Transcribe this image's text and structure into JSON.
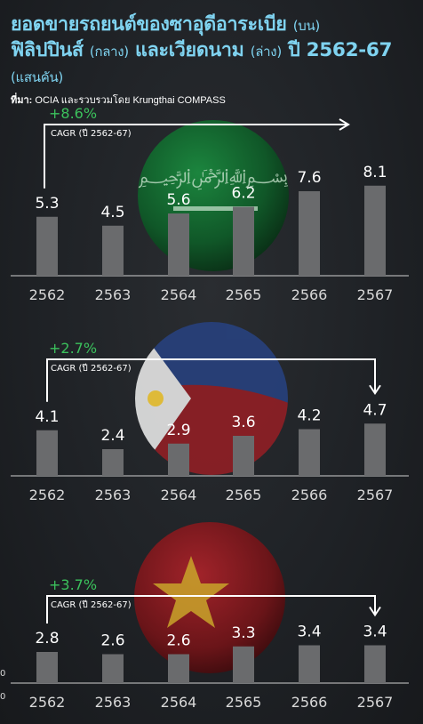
{
  "header": {
    "title_line1": "ยอดขายรถยนต์ของซาอุดีอาระเบีย",
    "title_line1_note": "(บน)",
    "title_line2_a": "ฟิลิปปินส์",
    "title_line2_a_note": "(กลาง)",
    "title_line2_b": "และเวียดนาม",
    "title_line2_b_note": "(ล่าง)",
    "title_line2_c": "ปี 2562-67",
    "title_unit": "(แสนคัน)",
    "source_label": "ที่มา:",
    "source_text": "OCIA และรวบรวมโดย Krungthai COMPASS"
  },
  "chart_data": [
    {
      "type": "bar",
      "title": "",
      "categories": [
        "2562",
        "2563",
        "2564",
        "2565",
        "2566",
        "2567"
      ],
      "values": [
        5.3,
        4.5,
        5.6,
        6.2,
        7.6,
        8.1
      ],
      "value_labels": [
        "5.3",
        "4.5",
        "5.6",
        "6.2",
        "7.6",
        "8.1"
      ],
      "ylim": [
        0,
        9
      ],
      "cagr": "+8.6%",
      "cagr_note": "CAGR (ปี 2562-67)",
      "bar_color": "#6a6b6d",
      "cagr_color": "#3bc15c",
      "background_flag": "saudi-arabia"
    },
    {
      "type": "bar",
      "title": "",
      "categories": [
        "2562",
        "2563",
        "2564",
        "2565",
        "2566",
        "2567"
      ],
      "values": [
        4.1,
        2.4,
        2.9,
        3.6,
        4.2,
        4.7
      ],
      "value_labels": [
        "4.1",
        "2.4",
        "2.9",
        "3.6",
        "4.2",
        "4.7"
      ],
      "ylim": [
        0,
        9
      ],
      "cagr": "+2.7%",
      "cagr_note": "CAGR (ปี 2562-67)",
      "bar_color": "#6a6b6d",
      "cagr_color": "#3bc15c",
      "background_flag": "philippines"
    },
    {
      "type": "bar",
      "title": "",
      "categories": [
        "2562",
        "2563",
        "2564",
        "2565",
        "2566",
        "2567"
      ],
      "values": [
        2.8,
        2.6,
        2.6,
        3.3,
        3.4,
        3.4
      ],
      "value_labels": [
        "2.8",
        "2.6",
        "2.6",
        "3.3",
        "3.4",
        "3.4"
      ],
      "ylim": [
        0,
        9
      ],
      "cagr": "+3.7%",
      "cagr_note": "CAGR (ปี 2562-67)",
      "bar_color": "#6a6b6d",
      "cagr_color": "#3bc15c",
      "background_flag": "vietnam"
    }
  ]
}
